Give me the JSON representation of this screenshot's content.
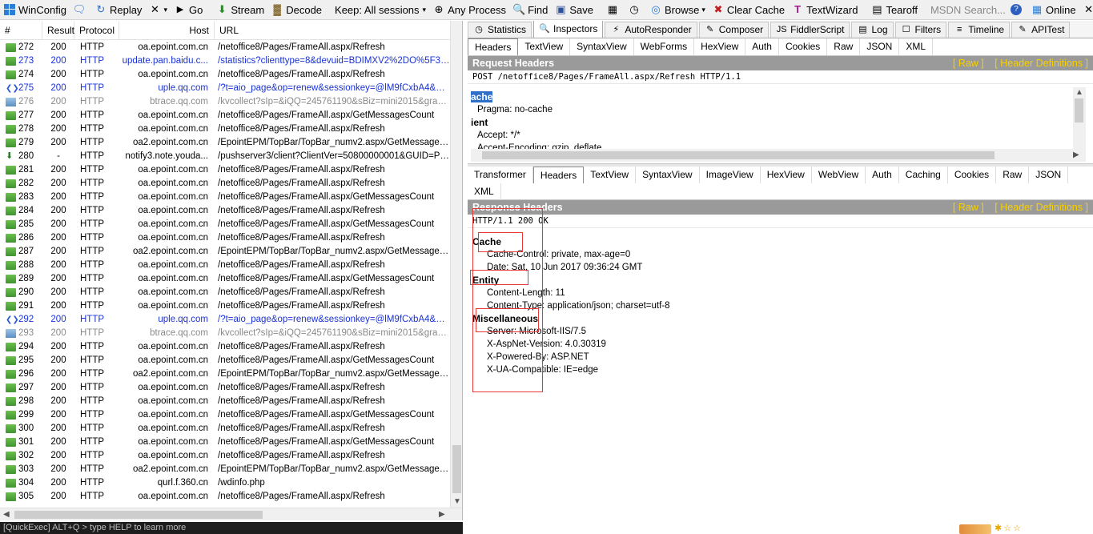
{
  "toolbar": {
    "items": [
      {
        "label": "WinConfig",
        "icon": "windows-icon"
      },
      {
        "label": "Replay",
        "icon": "replay-icon"
      },
      {
        "label": "",
        "icon": "remove-x-icon"
      },
      {
        "label": "Go",
        "icon": "go-arrow-icon"
      },
      {
        "label": "Stream",
        "icon": "stream-icon"
      },
      {
        "label": "Decode",
        "icon": "decode-icon"
      },
      {
        "label": "Keep: All sessions",
        "icon": "keep-dropdown-icon"
      },
      {
        "label": "Any Process",
        "icon": "crosshair-icon"
      },
      {
        "label": "Find",
        "icon": "find-icon"
      },
      {
        "label": "Save",
        "icon": "save-icon"
      },
      {
        "label": "",
        "icon": "camera-icon"
      },
      {
        "label": "",
        "icon": "timer-icon"
      },
      {
        "label": "Browse",
        "icon": "browser-icon"
      },
      {
        "label": "Clear Cache",
        "icon": "clear-cache-icon"
      },
      {
        "label": "TextWizard",
        "icon": "text-wizard-icon"
      },
      {
        "label": "Tearoff",
        "icon": "tearoff-icon"
      }
    ],
    "search_placeholder": "MSDN Search...",
    "online_label": "Online"
  },
  "sessions": {
    "columns": [
      "#",
      "Result",
      "Protocol",
      "Host",
      "URL"
    ],
    "rows": [
      {
        "num": "272",
        "result": "200",
        "protocol": "HTTP",
        "host": "oa.epoint.com.cn",
        "url": "/netoffice8/Pages/FrameAll.aspx/Refresh",
        "style": "normal",
        "icon": "doc"
      },
      {
        "num": "273",
        "result": "200",
        "protocol": "HTTP",
        "host": "update.pan.baidu.c...",
        "url": "/statistics?clienttype=8&devuid=BDIMXV2%2DO%5F3D...",
        "style": "blue",
        "icon": "doc"
      },
      {
        "num": "274",
        "result": "200",
        "protocol": "HTTP",
        "host": "oa.epoint.com.cn",
        "url": "/netoffice8/Pages/FrameAll.aspx/Refresh",
        "style": "normal",
        "icon": "doc"
      },
      {
        "num": "275",
        "result": "200",
        "protocol": "HTTP",
        "host": "uple.qq.com",
        "url": "/?t=aio_page&op=renew&sessionkey=@lM9fCxbA4&uin...",
        "style": "blue",
        "icon": "pair"
      },
      {
        "num": "276",
        "result": "200",
        "protocol": "HTTP",
        "host": "btrace.qq.com",
        "url": "/kvcollect?sIp=&iQQ=245761190&sBiz=mini2015&gray=...",
        "style": "gray",
        "icon": "img"
      },
      {
        "num": "277",
        "result": "200",
        "protocol": "HTTP",
        "host": "oa.epoint.com.cn",
        "url": "/netoffice8/Pages/FrameAll.aspx/GetMessagesCount",
        "style": "normal",
        "icon": "doc"
      },
      {
        "num": "278",
        "result": "200",
        "protocol": "HTTP",
        "host": "oa.epoint.com.cn",
        "url": "/netoffice8/Pages/FrameAll.aspx/Refresh",
        "style": "normal",
        "icon": "doc"
      },
      {
        "num": "279",
        "result": "200",
        "protocol": "HTTP",
        "host": "oa2.epoint.com.cn",
        "url": "/EpointEPM/TopBar/TopBar_numv2.aspx/GetMessagesC...",
        "style": "normal",
        "icon": "doc"
      },
      {
        "num": "280",
        "result": "-",
        "protocol": "HTTP",
        "host": "notify3.note.youda...",
        "url": "/pushserver3/client?ClientVer=50800000001&GUID=PC...",
        "style": "normal",
        "icon": "down"
      },
      {
        "num": "281",
        "result": "200",
        "protocol": "HTTP",
        "host": "oa.epoint.com.cn",
        "url": "/netoffice8/Pages/FrameAll.aspx/Refresh",
        "style": "normal",
        "icon": "doc"
      },
      {
        "num": "282",
        "result": "200",
        "protocol": "HTTP",
        "host": "oa.epoint.com.cn",
        "url": "/netoffice8/Pages/FrameAll.aspx/Refresh",
        "style": "normal",
        "icon": "doc"
      },
      {
        "num": "283",
        "result": "200",
        "protocol": "HTTP",
        "host": "oa.epoint.com.cn",
        "url": "/netoffice8/Pages/FrameAll.aspx/GetMessagesCount",
        "style": "normal",
        "icon": "doc"
      },
      {
        "num": "284",
        "result": "200",
        "protocol": "HTTP",
        "host": "oa.epoint.com.cn",
        "url": "/netoffice8/Pages/FrameAll.aspx/Refresh",
        "style": "normal",
        "icon": "doc"
      },
      {
        "num": "285",
        "result": "200",
        "protocol": "HTTP",
        "host": "oa.epoint.com.cn",
        "url": "/netoffice8/Pages/FrameAll.aspx/GetMessagesCount",
        "style": "normal",
        "icon": "doc"
      },
      {
        "num": "286",
        "result": "200",
        "protocol": "HTTP",
        "host": "oa.epoint.com.cn",
        "url": "/netoffice8/Pages/FrameAll.aspx/Refresh",
        "style": "normal",
        "icon": "doc"
      },
      {
        "num": "287",
        "result": "200",
        "protocol": "HTTP",
        "host": "oa2.epoint.com.cn",
        "url": "/EpointEPM/TopBar/TopBar_numv2.aspx/GetMessagesC...",
        "style": "normal",
        "icon": "doc"
      },
      {
        "num": "288",
        "result": "200",
        "protocol": "HTTP",
        "host": "oa.epoint.com.cn",
        "url": "/netoffice8/Pages/FrameAll.aspx/Refresh",
        "style": "normal",
        "icon": "doc"
      },
      {
        "num": "289",
        "result": "200",
        "protocol": "HTTP",
        "host": "oa.epoint.com.cn",
        "url": "/netoffice8/Pages/FrameAll.aspx/GetMessagesCount",
        "style": "normal",
        "icon": "doc"
      },
      {
        "num": "290",
        "result": "200",
        "protocol": "HTTP",
        "host": "oa.epoint.com.cn",
        "url": "/netoffice8/Pages/FrameAll.aspx/Refresh",
        "style": "normal",
        "icon": "doc"
      },
      {
        "num": "291",
        "result": "200",
        "protocol": "HTTP",
        "host": "oa.epoint.com.cn",
        "url": "/netoffice8/Pages/FrameAll.aspx/Refresh",
        "style": "normal",
        "icon": "doc"
      },
      {
        "num": "292",
        "result": "200",
        "protocol": "HTTP",
        "host": "uple.qq.com",
        "url": "/?t=aio_page&op=renew&sessionkey=@lM9fCxbA4&uin...",
        "style": "blue",
        "icon": "pair"
      },
      {
        "num": "293",
        "result": "200",
        "protocol": "HTTP",
        "host": "btrace.qq.com",
        "url": "/kvcollect?sIp=&iQQ=245761190&sBiz=mini2015&gray=...",
        "style": "gray",
        "icon": "img"
      },
      {
        "num": "294",
        "result": "200",
        "protocol": "HTTP",
        "host": "oa.epoint.com.cn",
        "url": "/netoffice8/Pages/FrameAll.aspx/Refresh",
        "style": "normal",
        "icon": "doc"
      },
      {
        "num": "295",
        "result": "200",
        "protocol": "HTTP",
        "host": "oa.epoint.com.cn",
        "url": "/netoffice8/Pages/FrameAll.aspx/GetMessagesCount",
        "style": "normal",
        "icon": "doc"
      },
      {
        "num": "296",
        "result": "200",
        "protocol": "HTTP",
        "host": "oa2.epoint.com.cn",
        "url": "/EpointEPM/TopBar/TopBar_numv2.aspx/GetMessagesC...",
        "style": "normal",
        "icon": "doc"
      },
      {
        "num": "297",
        "result": "200",
        "protocol": "HTTP",
        "host": "oa.epoint.com.cn",
        "url": "/netoffice8/Pages/FrameAll.aspx/Refresh",
        "style": "normal",
        "icon": "doc"
      },
      {
        "num": "298",
        "result": "200",
        "protocol": "HTTP",
        "host": "oa.epoint.com.cn",
        "url": "/netoffice8/Pages/FrameAll.aspx/Refresh",
        "style": "normal",
        "icon": "doc"
      },
      {
        "num": "299",
        "result": "200",
        "protocol": "HTTP",
        "host": "oa.epoint.com.cn",
        "url": "/netoffice8/Pages/FrameAll.aspx/GetMessagesCount",
        "style": "normal",
        "icon": "doc"
      },
      {
        "num": "300",
        "result": "200",
        "protocol": "HTTP",
        "host": "oa.epoint.com.cn",
        "url": "/netoffice8/Pages/FrameAll.aspx/Refresh",
        "style": "normal",
        "icon": "doc"
      },
      {
        "num": "301",
        "result": "200",
        "protocol": "HTTP",
        "host": "oa.epoint.com.cn",
        "url": "/netoffice8/Pages/FrameAll.aspx/GetMessagesCount",
        "style": "normal",
        "icon": "doc"
      },
      {
        "num": "302",
        "result": "200",
        "protocol": "HTTP",
        "host": "oa.epoint.com.cn",
        "url": "/netoffice8/Pages/FrameAll.aspx/Refresh",
        "style": "normal",
        "icon": "doc"
      },
      {
        "num": "303",
        "result": "200",
        "protocol": "HTTP",
        "host": "oa2.epoint.com.cn",
        "url": "/EpointEPM/TopBar/TopBar_numv2.aspx/GetMessagesC...",
        "style": "normal",
        "icon": "doc"
      },
      {
        "num": "304",
        "result": "200",
        "protocol": "HTTP",
        "host": "qurl.f.360.cn",
        "url": "/wdinfo.php",
        "style": "normal",
        "icon": "doc"
      },
      {
        "num": "305",
        "result": "200",
        "protocol": "HTTP",
        "host": "oa.epoint.com.cn",
        "url": "/netoffice8/Pages/FrameAll.aspx/Refresh",
        "style": "normal",
        "icon": "doc"
      }
    ]
  },
  "quickexec": "[QuickExec] ALT+Q > type HELP to learn more",
  "inspector": {
    "main_tabs": [
      {
        "label": "Statistics",
        "icon": "statistics-icon"
      },
      {
        "label": "Inspectors",
        "icon": "inspectors-icon",
        "active": true
      },
      {
        "label": "AutoResponder",
        "icon": "autoresponder-icon"
      },
      {
        "label": "Composer",
        "icon": "composer-icon"
      },
      {
        "label": "FiddlerScript",
        "icon": "fiddlerscript-icon"
      },
      {
        "label": "Log",
        "icon": "log-icon"
      },
      {
        "label": "Filters",
        "icon": "filters-icon"
      },
      {
        "label": "Timeline",
        "icon": "timeline-icon"
      },
      {
        "label": "APITest",
        "icon": "apitest-icon"
      }
    ],
    "request_tabs": [
      "Headers",
      "TextView",
      "SyntaxView",
      "WebForms",
      "HexView",
      "Auth",
      "Cookies",
      "Raw",
      "JSON",
      "XML"
    ],
    "request_active": "Headers",
    "request_title": "Request Headers",
    "raw_link": "[ Raw ]",
    "defs_link": "[ Header Definitions ]",
    "request_line": "POST /netoffice8/Pages/FrameAll.aspx/Refresh HTTP/1.1",
    "request_groups": [
      {
        "name": "ache",
        "items": [
          "Pragma: no-cache"
        ]
      },
      {
        "name": "ient",
        "items": [
          "Accept: */*",
          "Accept-Encoding: gzip, deflate"
        ]
      }
    ],
    "response_tabs": [
      "Transformer",
      "Headers",
      "TextView",
      "SyntaxView",
      "ImageView",
      "HexView",
      "WebView",
      "Auth",
      "Caching",
      "Cookies",
      "Raw",
      "JSON",
      "XML"
    ],
    "response_active": "Headers",
    "response_title": "Response Headers",
    "status_line": "HTTP/1.1 200 OK",
    "response_groups": [
      {
        "name": "Cache",
        "items": [
          "Cache-Control: private, max-age=0",
          "Date: Sat, 10 Jun 2017 09:36:24 GMT"
        ]
      },
      {
        "name": "Entity",
        "items": [
          "Content-Length: 11",
          "Content-Type: application/json; charset=utf-8"
        ]
      },
      {
        "name": "Miscellaneous",
        "items": [
          "Server: Microsoft-IIS/7.5",
          "X-AspNet-Version: 4.0.30319",
          "X-Powered-By: ASP.NET",
          "X-UA-Compatible: IE=edge"
        ]
      }
    ]
  },
  "colors": {
    "accent_link": "#f7d000",
    "band": "#9a9a9a",
    "annotation": "#e63a3a",
    "blue_row": "#1a33d4"
  }
}
